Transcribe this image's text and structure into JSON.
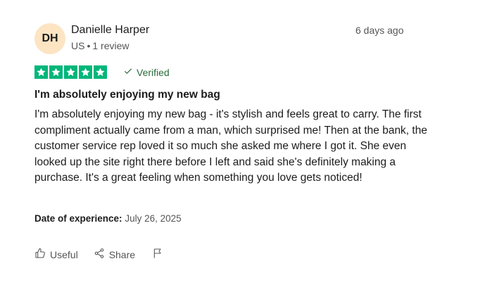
{
  "review": {
    "author": {
      "initials": "DH",
      "name": "Danielle Harper",
      "country": "US",
      "review_count": "1 review"
    },
    "posted_ago": "6 days ago",
    "rating": 5,
    "verified_label": "Verified",
    "title": "I'm absolutely enjoying my new bag",
    "body": "I'm absolutely enjoying my new bag - it's stylish and feels great to carry. The first compliment actually came from a man, which surprised me! Then at the bank, the customer service rep loved it so much she asked me where I got it. She even looked up the site right there before I left and said she's definitely making a purchase. It's a great feeling when something you love gets noticed!",
    "experience": {
      "label": "Date of experience:",
      "date": "July 26, 2025"
    }
  },
  "actions": {
    "useful_label": "Useful",
    "share_label": "Share"
  },
  "colors": {
    "star_green": "#00b67a",
    "avatar_bg": "#fde4c3",
    "verified_green": "#2b6b3b"
  },
  "icons": [
    "star-icon",
    "checkmark-icon",
    "thumbs-up-icon",
    "share-icon",
    "flag-icon"
  ]
}
